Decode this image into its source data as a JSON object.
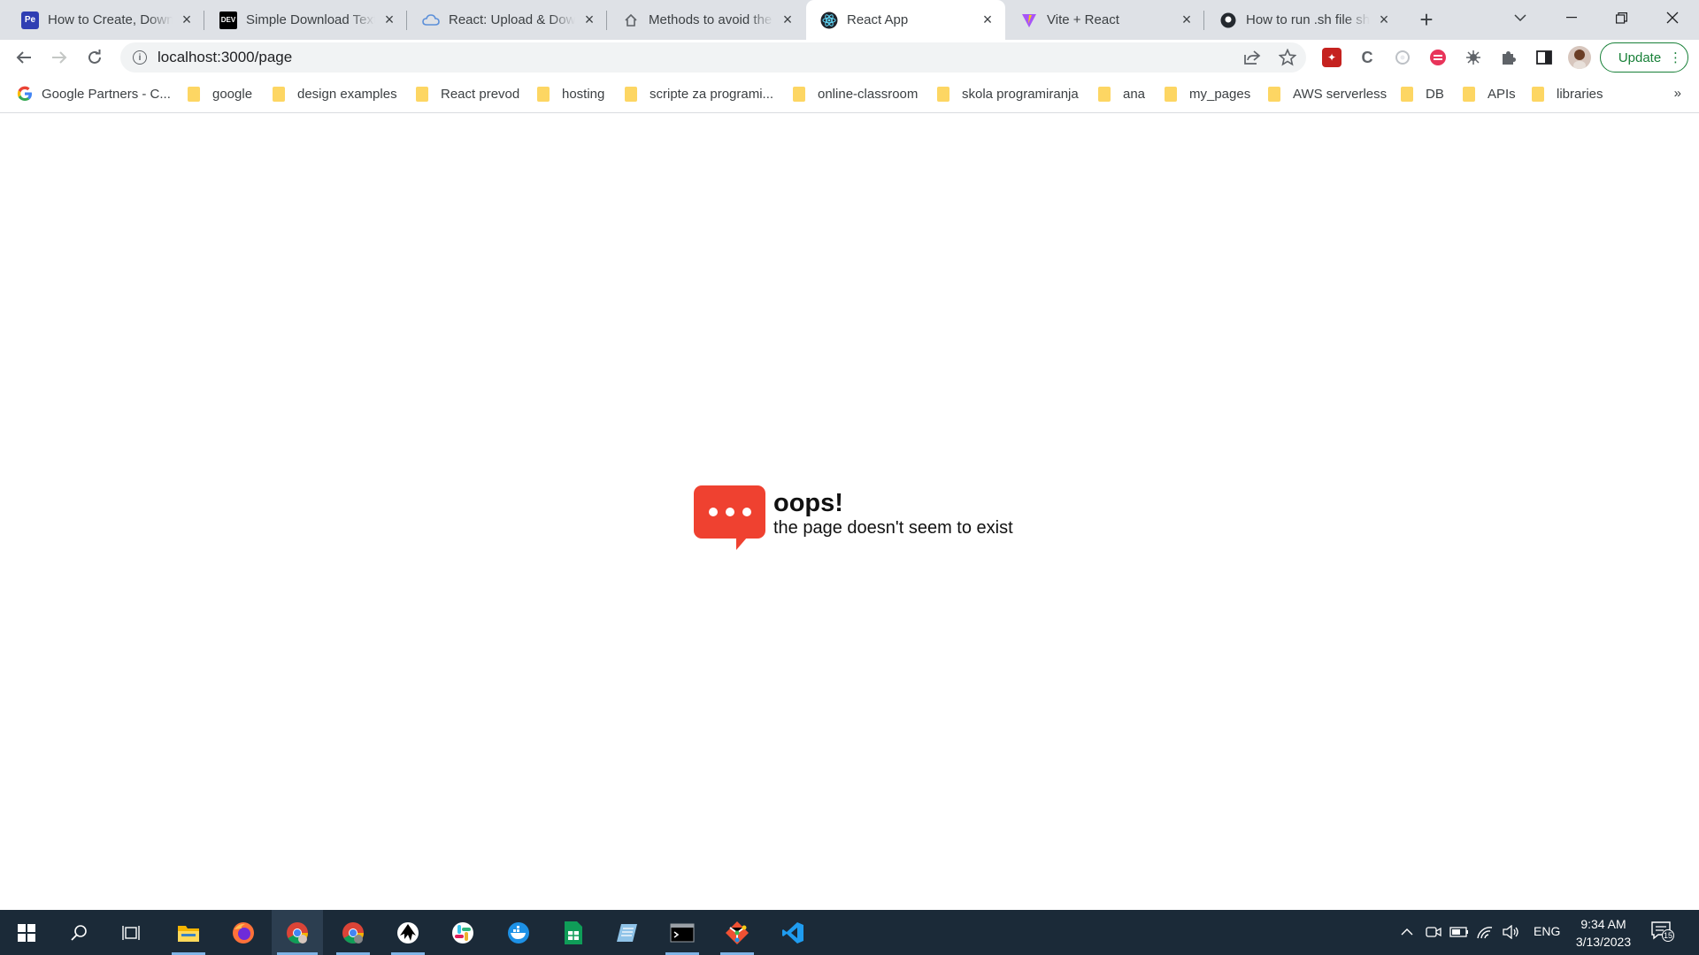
{
  "browser": {
    "tabs": [
      {
        "title": "How to Create, Downl",
        "icon": "pe-icon",
        "active": false
      },
      {
        "title": "Simple Download Text",
        "icon": "dev-icon",
        "active": false
      },
      {
        "title": "React: Upload & Dow",
        "icon": "cloud-icon",
        "active": false
      },
      {
        "title": "Methods to avoid the",
        "icon": "house-icon",
        "active": false
      },
      {
        "title": "React App",
        "icon": "react-icon",
        "active": true
      },
      {
        "title": "Vite + React",
        "icon": "vite-icon",
        "active": false
      },
      {
        "title": "How to run .sh file sh",
        "icon": "github-icon",
        "active": false
      }
    ],
    "url": "localhost:3000/page",
    "update_label": "Update",
    "bookmarks": [
      {
        "label": "Google Partners - C...",
        "type": "google"
      },
      {
        "label": "google",
        "type": "folder"
      },
      {
        "label": "design examples",
        "type": "folder"
      },
      {
        "label": "React prevod",
        "type": "folder"
      },
      {
        "label": "hosting",
        "type": "folder"
      },
      {
        "label": "scripte za programi...",
        "type": "folder"
      },
      {
        "label": "online-classroom",
        "type": "folder"
      },
      {
        "label": "skola programiranja",
        "type": "folder"
      },
      {
        "label": "ana",
        "type": "folder"
      },
      {
        "label": "my_pages",
        "type": "folder"
      },
      {
        "label": "AWS serverless",
        "type": "folder"
      },
      {
        "label": "DB",
        "type": "folder"
      },
      {
        "label": "APIs",
        "type": "folder"
      },
      {
        "label": "libraries",
        "type": "folder"
      }
    ],
    "bookmarks_more": "»"
  },
  "page": {
    "title": "oops!",
    "subtitle": "the page doesn't seem to exist",
    "accent_color": "#ef4130"
  },
  "taskbar": {
    "apps": [
      "start",
      "search",
      "task-view",
      "file-explorer",
      "firefox",
      "chrome",
      "chrome-profile",
      "inkscape",
      "slack",
      "docker",
      "sheets",
      "notepad",
      "terminal",
      "git",
      "vscode"
    ],
    "language": "ENG",
    "time": "9:34 AM",
    "date": "3/13/2023",
    "notifications": "15"
  }
}
